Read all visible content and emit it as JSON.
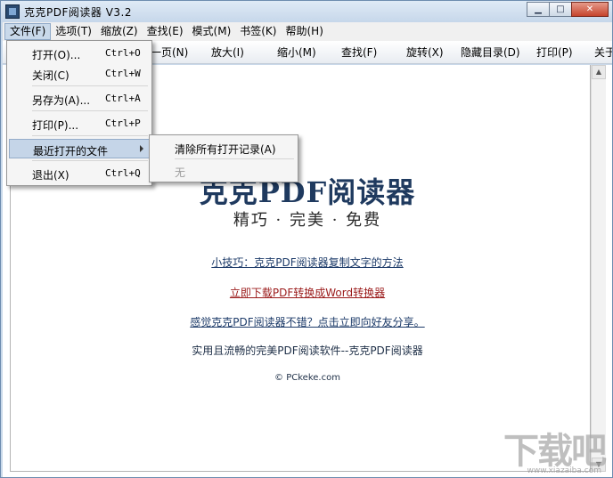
{
  "window": {
    "title": "克克PDF阅读器 V3.2",
    "controls": {
      "minimize": "▁",
      "maximize": "□",
      "close": "✕"
    }
  },
  "menubar": {
    "items": [
      "文件(F)",
      "选项(T)",
      "缩放(Z)",
      "查找(E)",
      "模式(M)",
      "书签(K)",
      "帮助(H)"
    ]
  },
  "toolbar": {
    "buttons": [
      "一页(N)",
      "放大(I)",
      "缩小(M)",
      "查找(F)",
      "旋转(X)",
      "隐藏目录(D)",
      "打印(P)",
      "关于"
    ]
  },
  "file_menu": {
    "items": [
      {
        "label": "打开(O)...",
        "shortcut": "Ctrl+O"
      },
      {
        "label": "关闭(C)",
        "shortcut": "Ctrl+W"
      },
      {
        "label": "另存为(A)...",
        "shortcut": "Ctrl+A"
      },
      {
        "label": "打印(P)...",
        "shortcut": "Ctrl+P"
      },
      {
        "label": "最近打开的文件",
        "shortcut": ""
      },
      {
        "label": "退出(X)",
        "shortcut": "Ctrl+Q"
      }
    ]
  },
  "recent_submenu": {
    "items": [
      {
        "label": "清除所有打开记录(A)"
      },
      {
        "label": "无"
      }
    ]
  },
  "document": {
    "logo": "克克PDF阅读器",
    "slogan": "精巧 · 完美 · 免费",
    "tip_link": "小技巧：克克PDF阅读器复制文字的方法",
    "download_link": "立即下载PDF转换成Word转换器",
    "share_link": "感觉克克PDF阅读器不错？点击立即向好友分享。",
    "description": "实用且流畅的完美PDF阅读软件--克克PDF阅读器",
    "copyright": "© PCkeke.com"
  },
  "watermark": {
    "text": "下载吧",
    "sub": "www.xiazaiba.com"
  }
}
